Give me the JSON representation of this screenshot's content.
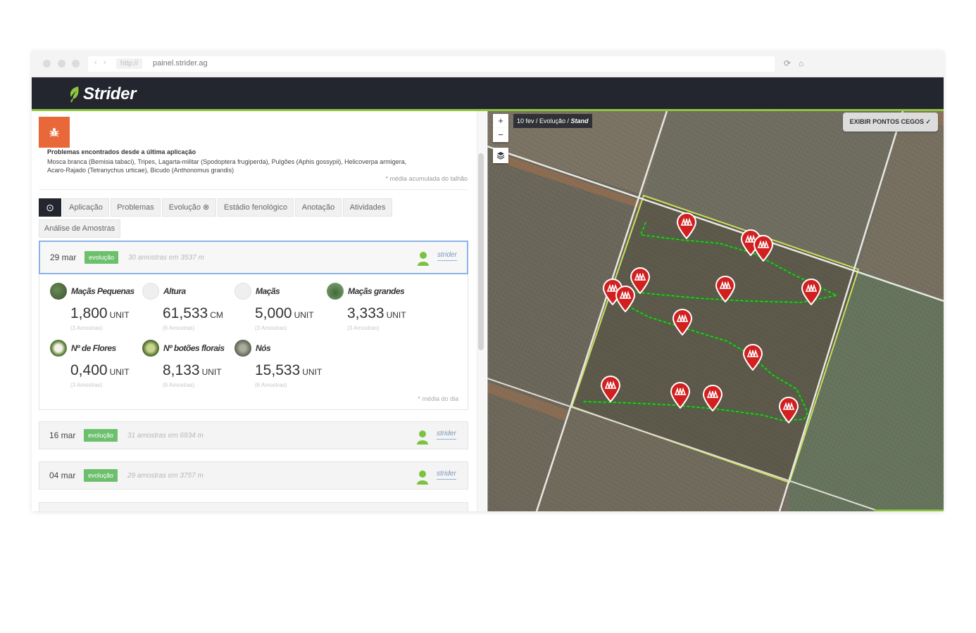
{
  "browser": {
    "nav_arrows": "‹ ›",
    "protocol": "http://",
    "url": "painel.strider.ag"
  },
  "header": {
    "logo_text": "Strider"
  },
  "problems": {
    "icon": "bug-icon",
    "title": "Problemas encontrados desde a última aplicação",
    "list_line1": "Mosca branca (Bemisia tabaci), Tripes, Lagarta-militar (Spodoptera frugiperda), Pulgões (Aphis gossypii), Helicoverpa armigera,",
    "list_line2": "Acaro-Rajado (Tetranychus urticae), Bicudo (Anthonomus grandis)",
    "note": "* média acumulada do talhão"
  },
  "tabs": {
    "active_icon": "⊙",
    "items": [
      "Aplicação",
      "Problemas",
      "Evolução ⊗",
      "Estádio fenológico",
      "Anotação",
      "Atividades",
      "Análise de Amostras"
    ]
  },
  "samples": [
    {
      "date": "29 mar",
      "badge": "evolução",
      "meta": "30 amostras em 3537 m",
      "user": "strider"
    },
    {
      "date": "16 mar",
      "badge": "evolução",
      "meta": "31 amostras em 6934 m",
      "user": "strider"
    },
    {
      "date": "04 mar",
      "badge": "evolução",
      "meta": "29 amostras em 3757 m",
      "user": "strider"
    }
  ],
  "metrics": [
    {
      "name": "Maçãs Pequenas",
      "value": "1,800",
      "unit": "UNIT",
      "count": "(3 Amostras)",
      "icon": "small-boll-icon",
      "color": "#4a6a3a"
    },
    {
      "name": "Altura",
      "value": "61,533",
      "unit": "CM",
      "count": "(6 Amostras)",
      "icon": "height-icon",
      "color": "#eeeeee"
    },
    {
      "name": "Maçãs",
      "value": "5,000",
      "unit": "UNIT",
      "count": "(3 Amostras)",
      "icon": "boll-icon",
      "color": "#eeeeee"
    },
    {
      "name": "Maçãs grandes",
      "value": "3,333",
      "unit": "UNIT",
      "count": "(3 Amostras)",
      "icon": "large-boll-icon",
      "color": "#4d7a4a"
    },
    {
      "name": "Nº de Flores",
      "value": "0,400",
      "unit": "UNIT",
      "count": "(3 Amostras)",
      "icon": "flower-icon",
      "color": "#7a9a5a"
    },
    {
      "name": "Nº botões florais",
      "value": "8,133",
      "unit": "UNIT",
      "count": "(6 Amostras)",
      "icon": "flower-bud-icon",
      "color": "#6f8d3c"
    },
    {
      "name": "Nós",
      "value": "15,533",
      "unit": "UNIT",
      "count": "(6 Amostras)",
      "icon": "node-icon",
      "color": "#7b8270"
    }
  ],
  "day_note": "* média do dia",
  "map": {
    "zoom_in": "+",
    "zoom_out": "−",
    "crumb_prefix": "10 fev / Evolução / ",
    "crumb_bold": "Stand",
    "blind_spots_label": "EXIBIR PONTOS CEGOS ✓"
  },
  "colors": {
    "header_bg": "#23252f",
    "brand_green": "#8dc63f",
    "badge_green": "#6cc06c",
    "bug_orange": "#e8683a",
    "pin_red": "#d21f1f"
  }
}
